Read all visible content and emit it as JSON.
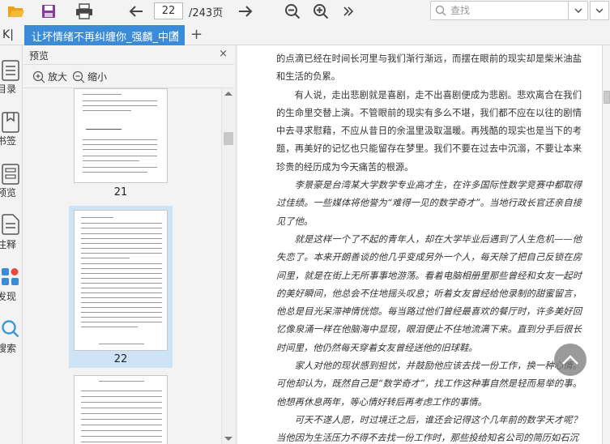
{
  "toolbar": {
    "current_page": "22",
    "page_total": "/243页",
    "search_placeholder": "查找"
  },
  "tab": {
    "title": "让坏情绪不再纠缠你_强麟_中国",
    "close": "×",
    "add": "+"
  },
  "collapse_label": "K|",
  "leftbar": {
    "items": [
      {
        "label": "目录"
      },
      {
        "label": "书签"
      },
      {
        "label": "预览"
      },
      {
        "label": "注释"
      },
      {
        "label": "发现"
      },
      {
        "label": "搜索"
      }
    ]
  },
  "preview": {
    "title": "预览",
    "close": "×",
    "zoom_in": "放大",
    "zoom_out": "缩小",
    "thumbnails": [
      {
        "number": "21"
      },
      {
        "number": "22"
      }
    ]
  },
  "document": {
    "paragraphs": [
      "的点滴已经在时间长河里与我们渐行渐远，而摆在眼前的现实却是柴米油盐和生活的负累。",
      "有人说，走出悲剧就是喜剧，走不出喜剧便成为悲剧。悲欢离合在我们的生命里交替上演。不管眼前的现实有多么不堪，我们都不应在以往的剧情中去寻求慰藉，不应从昔日的余温里汲取温暖。再残酷的现实也是当下的考题，再美好的记忆也只能留存在梦里。我们不要在过去中沉溺，不要让本来珍贵的经历成为今天痛苦的根源。",
      "李景豪是台湾某大学数学专业高才生，在许多国际性数学竞赛中都取得过佳绩。一些媒体将他誉为“难得一见的数学奇才”。当地行政长官还亲自接见了他。",
      "就是这样一个了不起的青年人，却在大学毕业后遇到了人生危机——他失恋了。本来开朗善谈的他几乎变成另外一个人，每天除了把自己反锁在房间里，就是在街上无所事事地游荡。看着电脑相册里那些曾经和女友一起时的美好瞬间，他总会不住地摇头叹息；听着女友曾经给他录制的甜蜜留言，他总是目光呆滞神情恍惚。每当路过他们曾经最喜欢的餐厅时，许多美好回忆像泉涌一样在他脑海中显现，眼泪便止不住地流满下来。直到分手后很长时间里，他仍然每天穿着女友曾经送他的旧球鞋。",
      "家人对他的现状感到担忧，并鼓励他应该去找一份工作，换一种心情。可他却认为，既然自己是“数学奇才”，找工作这种事自然是轻而易举的事。他想再休息两年，等心情好转后再考虑工作的事情。",
      "可天不遂人愿，时过境迁之后，谁还会记得这个几年前的数学天才呢？当他因为生活压力不得不去找一份工作时，那些投给知名公司的简历如石沉"
    ]
  }
}
